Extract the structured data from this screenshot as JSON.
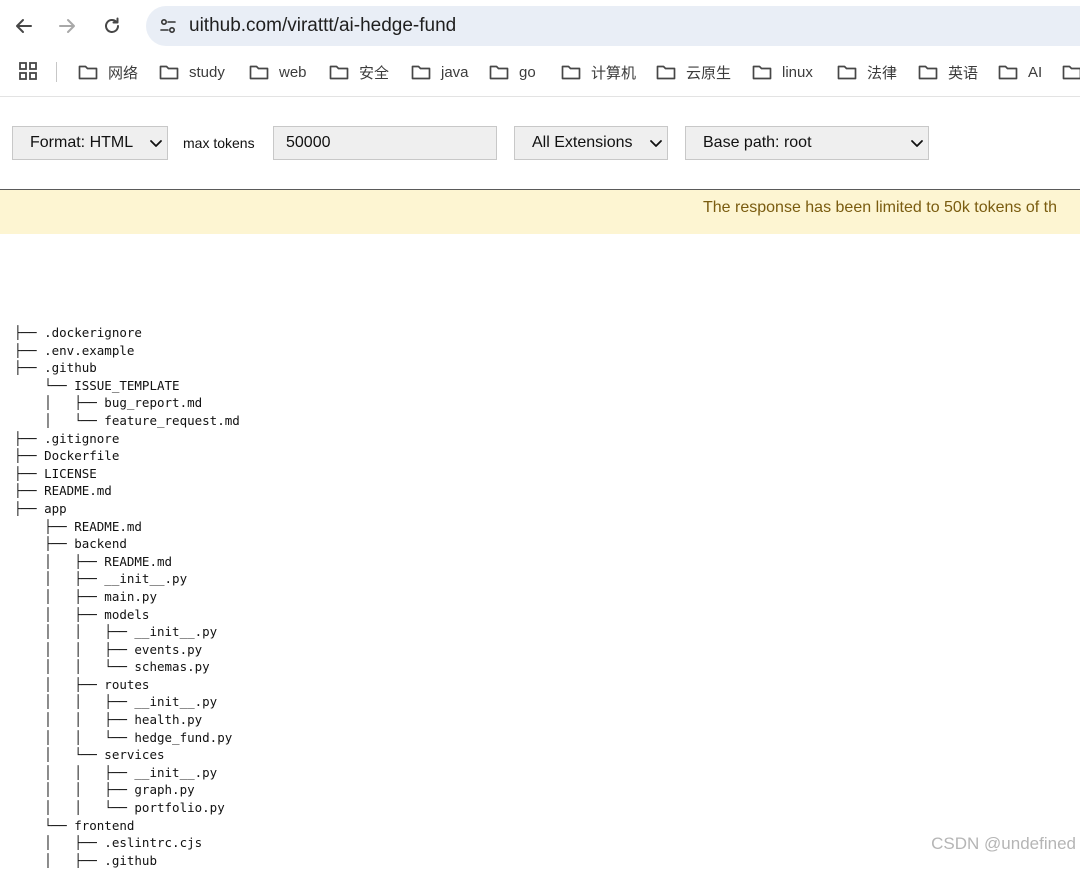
{
  "browser": {
    "url": "uithub.com/virattt/ai-hedge-fund",
    "bookmarks": [
      "网络",
      "study",
      "web",
      "安全",
      "java",
      "go",
      "计算机",
      "云原生",
      "linux",
      "法律",
      "英语",
      "AI"
    ]
  },
  "toolbar": {
    "format_label": "Format: HTML",
    "max_tokens_label": "max tokens",
    "max_tokens_value": "50000",
    "extensions_label": "All Extensions",
    "base_path_label": "Base path: root"
  },
  "notice": {
    "text": "The response has been limited to 50k tokens of th"
  },
  "tree": [
    "├── .dockerignore",
    "├── .env.example",
    "├── .github",
    "    └── ISSUE_TEMPLATE",
    "    │   ├── bug_report.md",
    "    │   └── feature_request.md",
    "├── .gitignore",
    "├── Dockerfile",
    "├── LICENSE",
    "├── README.md",
    "├── app",
    "    ├── README.md",
    "    ├── backend",
    "    │   ├── README.md",
    "    │   ├── __init__.py",
    "    │   ├── main.py",
    "    │   ├── models",
    "    │   │   ├── __init__.py",
    "    │   │   ├── events.py",
    "    │   │   └── schemas.py",
    "    │   ├── routes",
    "    │   │   ├── __init__.py",
    "    │   │   ├── health.py",
    "    │   │   └── hedge_fund.py",
    "    │   └── services",
    "    │   │   ├── __init__.py",
    "    │   │   ├── graph.py",
    "    │   │   └── portfolio.py",
    "    └── frontend",
    "    │   ├── .eslintrc.cjs",
    "    │   ├── .github"
  ],
  "watermark": "CSDN @undefined"
}
